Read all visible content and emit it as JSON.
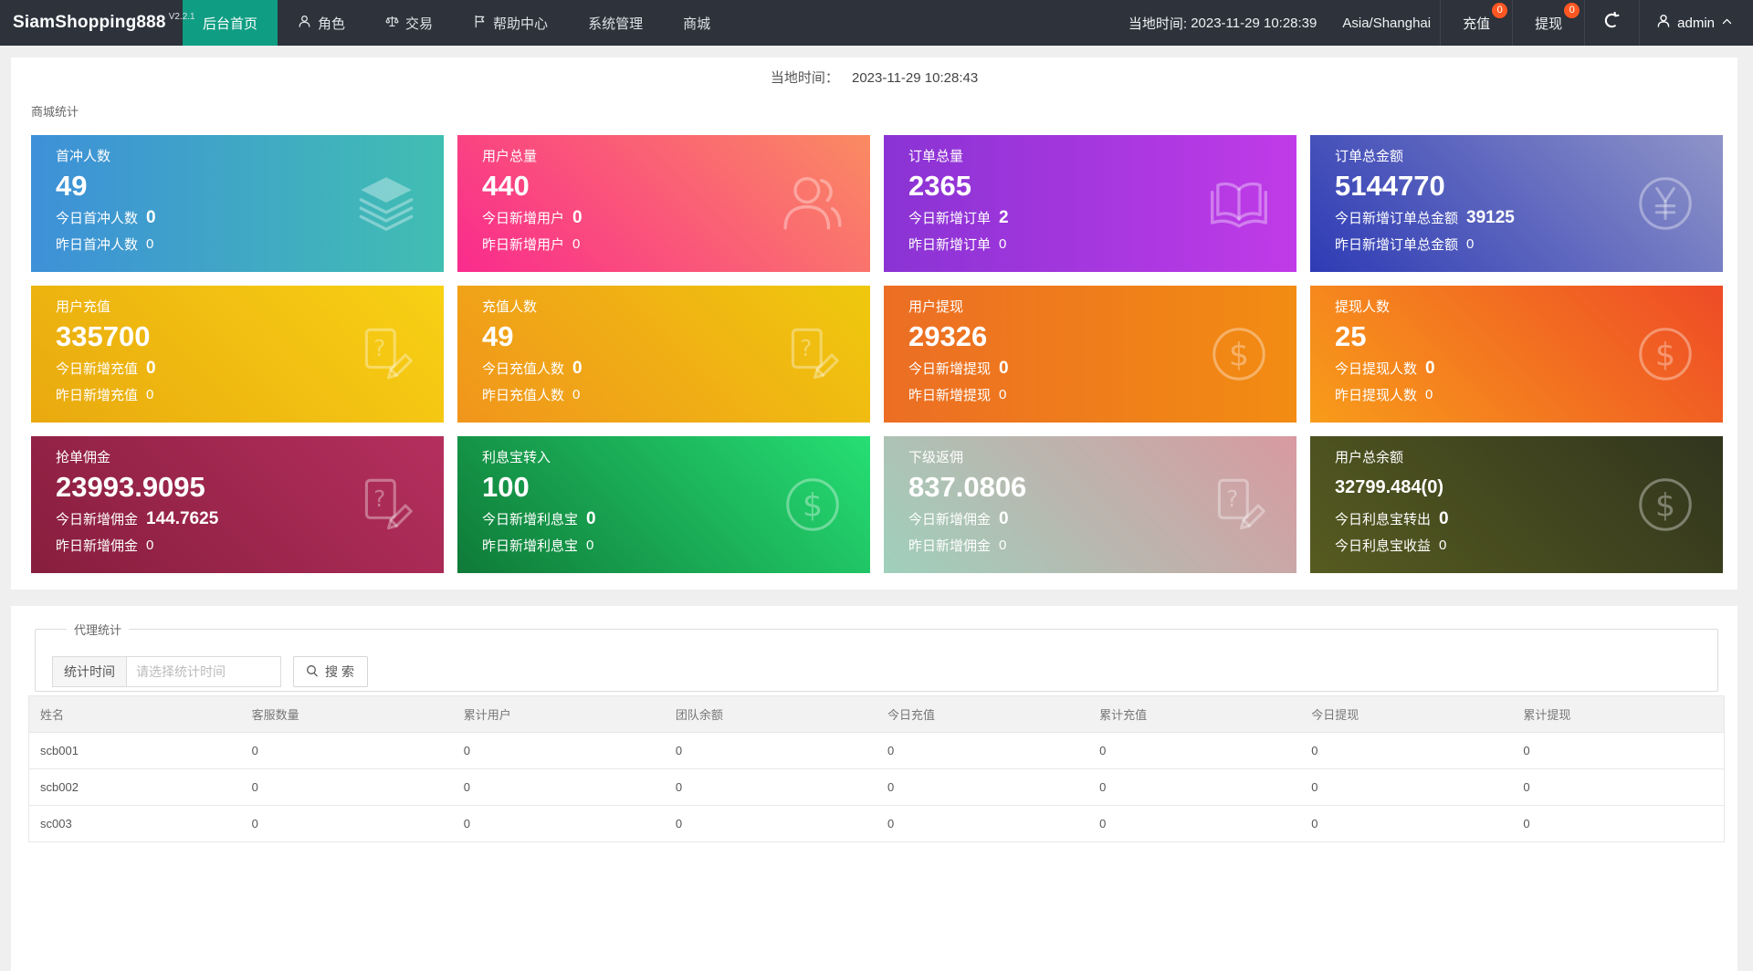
{
  "navbar": {
    "logo": "SiamShopping888",
    "version": "V2.2.1",
    "menu": [
      {
        "label": "后台首页",
        "icon": null,
        "active": true
      },
      {
        "label": "角色",
        "icon": "user",
        "active": false
      },
      {
        "label": "交易",
        "icon": "scales",
        "active": false
      },
      {
        "label": "帮助中心",
        "icon": "flag",
        "active": false
      },
      {
        "label": "系统管理",
        "icon": null,
        "active": false
      },
      {
        "label": "商城",
        "icon": null,
        "active": false
      }
    ],
    "local_time_label": "当地时间:",
    "local_time": "2023-11-29 10:28:39",
    "timezone": "Asia/Shanghai",
    "recharge": {
      "label": "充值",
      "badge": "0"
    },
    "withdraw": {
      "label": "提现",
      "badge": "0"
    },
    "username": "admin"
  },
  "overview": {
    "time_label": "当地时间：",
    "time_value": "2023-11-29 10:28:43",
    "section_title": "商城统计",
    "cards": [
      {
        "title": "首冲人数",
        "value": "49",
        "icon": "layers",
        "colors": [
          "#3e90d8",
          "#41beb2"
        ],
        "angle": "90deg",
        "small": false,
        "lines": [
          {
            "label": "今日首冲人数",
            "value": "0",
            "bold": true
          },
          {
            "label": "昨日首冲人数",
            "value": "0",
            "bold": false
          }
        ]
      },
      {
        "title": "用户总量",
        "value": "440",
        "icon": "users",
        "colors": [
          "#fa2b8d",
          "#fa8b62"
        ],
        "angle": "45deg",
        "small": false,
        "lines": [
          {
            "label": "今日新增用户",
            "value": "0",
            "bold": true
          },
          {
            "label": "昨日新增用户",
            "value": "0",
            "bold": false
          }
        ]
      },
      {
        "title": "订单总量",
        "value": "2365",
        "icon": "book",
        "colors": [
          "#8a33d4",
          "#c03be8"
        ],
        "angle": "90deg",
        "small": false,
        "lines": [
          {
            "label": "今日新增订单",
            "value": "2",
            "bold": true
          },
          {
            "label": "昨日新增订单",
            "value": "0",
            "bold": false
          }
        ]
      },
      {
        "title": "订单总金额",
        "value": "5144770",
        "icon": "yen-circle",
        "colors": [
          "#2e3bb5",
          "#8f94c8"
        ],
        "angle": "45deg",
        "small": false,
        "lines": [
          {
            "label": "今日新增订单总金额",
            "value": "39125",
            "bold": true
          },
          {
            "label": "昨日新增订单总金额",
            "value": "0",
            "bold": false
          }
        ]
      },
      {
        "title": "用户充值",
        "value": "335700",
        "icon": "doc-edit",
        "colors": [
          "#e9a90f",
          "#f8d114"
        ],
        "angle": "45deg",
        "small": false,
        "lines": [
          {
            "label": "今日新增充值",
            "value": "0",
            "bold": true
          },
          {
            "label": "昨日新增充值",
            "value": "0",
            "bold": false
          }
        ]
      },
      {
        "title": "充值人数",
        "value": "49",
        "icon": "doc-edit",
        "colors": [
          "#f1951c",
          "#efc90d"
        ],
        "angle": "45deg",
        "small": false,
        "lines": [
          {
            "label": "今日充值人数",
            "value": "0",
            "bold": true
          },
          {
            "label": "昨日充值人数",
            "value": "0",
            "bold": false
          }
        ]
      },
      {
        "title": "用户提现",
        "value": "29326",
        "icon": "dollar-circle",
        "colors": [
          "#ec6e24",
          "#f28c12"
        ],
        "angle": "90deg",
        "small": false,
        "lines": [
          {
            "label": "今日新增提现",
            "value": "0",
            "bold": true
          },
          {
            "label": "昨日新增提现",
            "value": "0",
            "bold": false
          }
        ]
      },
      {
        "title": "提现人数",
        "value": "25",
        "icon": "dollar-circle",
        "colors": [
          "#f89c1a",
          "#ee4b26"
        ],
        "angle": "45deg",
        "small": false,
        "lines": [
          {
            "label": "今日提现人数",
            "value": "0",
            "bold": true
          },
          {
            "label": "昨日提现人数",
            "value": "0",
            "bold": false
          }
        ]
      },
      {
        "title": "抢单佣金",
        "value": "23993.9095",
        "icon": "doc-edit",
        "colors": [
          "#871e3e",
          "#b52f5e"
        ],
        "angle": "45deg",
        "small": false,
        "lines": [
          {
            "label": "今日新增佣金",
            "value": "144.7625",
            "bold": true
          },
          {
            "label": "昨日新增佣金",
            "value": "0",
            "bold": false
          }
        ]
      },
      {
        "title": "利息宝转入",
        "value": "100",
        "icon": "dollar-circle",
        "colors": [
          "#0f7a38",
          "#26df74"
        ],
        "angle": "45deg",
        "small": false,
        "lines": [
          {
            "label": "今日新增利息宝",
            "value": "0",
            "bold": true
          },
          {
            "label": "昨日新增利息宝",
            "value": "0",
            "bold": false
          }
        ]
      },
      {
        "title": "下级返佣",
        "value": "837.0806",
        "icon": "doc-edit",
        "colors": [
          "#9fd0bc",
          "#d89aa0"
        ],
        "angle": "45deg",
        "small": false,
        "lines": [
          {
            "label": "今日新增佣金",
            "value": "0",
            "bold": true
          },
          {
            "label": "昨日新增佣金",
            "value": "0",
            "bold": false
          }
        ]
      },
      {
        "title": "用户总余额",
        "value": "32799.484(0)",
        "icon": "dollar-circle",
        "colors": [
          "#565b20",
          "#31351e"
        ],
        "angle": "45deg",
        "small": true,
        "lines": [
          {
            "label": "今日利息宝转出",
            "value": "0",
            "bold": true
          },
          {
            "label": "今日利息宝收益",
            "value": "0",
            "bold": false
          }
        ]
      }
    ]
  },
  "agent": {
    "legend": "代理统计",
    "filter_label": "统计时间",
    "filter_placeholder": "请选择统计时间",
    "search_label": "搜索",
    "table": {
      "headers": [
        "姓名",
        "客服数量",
        "累计用户",
        "团队余额",
        "今日充值",
        "累计充值",
        "今日提现",
        "累计提现"
      ],
      "rows": [
        [
          "scb001",
          "0",
          "0",
          "0",
          "0",
          "0",
          "0",
          "0"
        ],
        [
          "scb002",
          "0",
          "0",
          "0",
          "0",
          "0",
          "0",
          "0"
        ],
        [
          "sc003",
          "0",
          "0",
          "0",
          "0",
          "0",
          "0",
          "0"
        ]
      ]
    }
  }
}
